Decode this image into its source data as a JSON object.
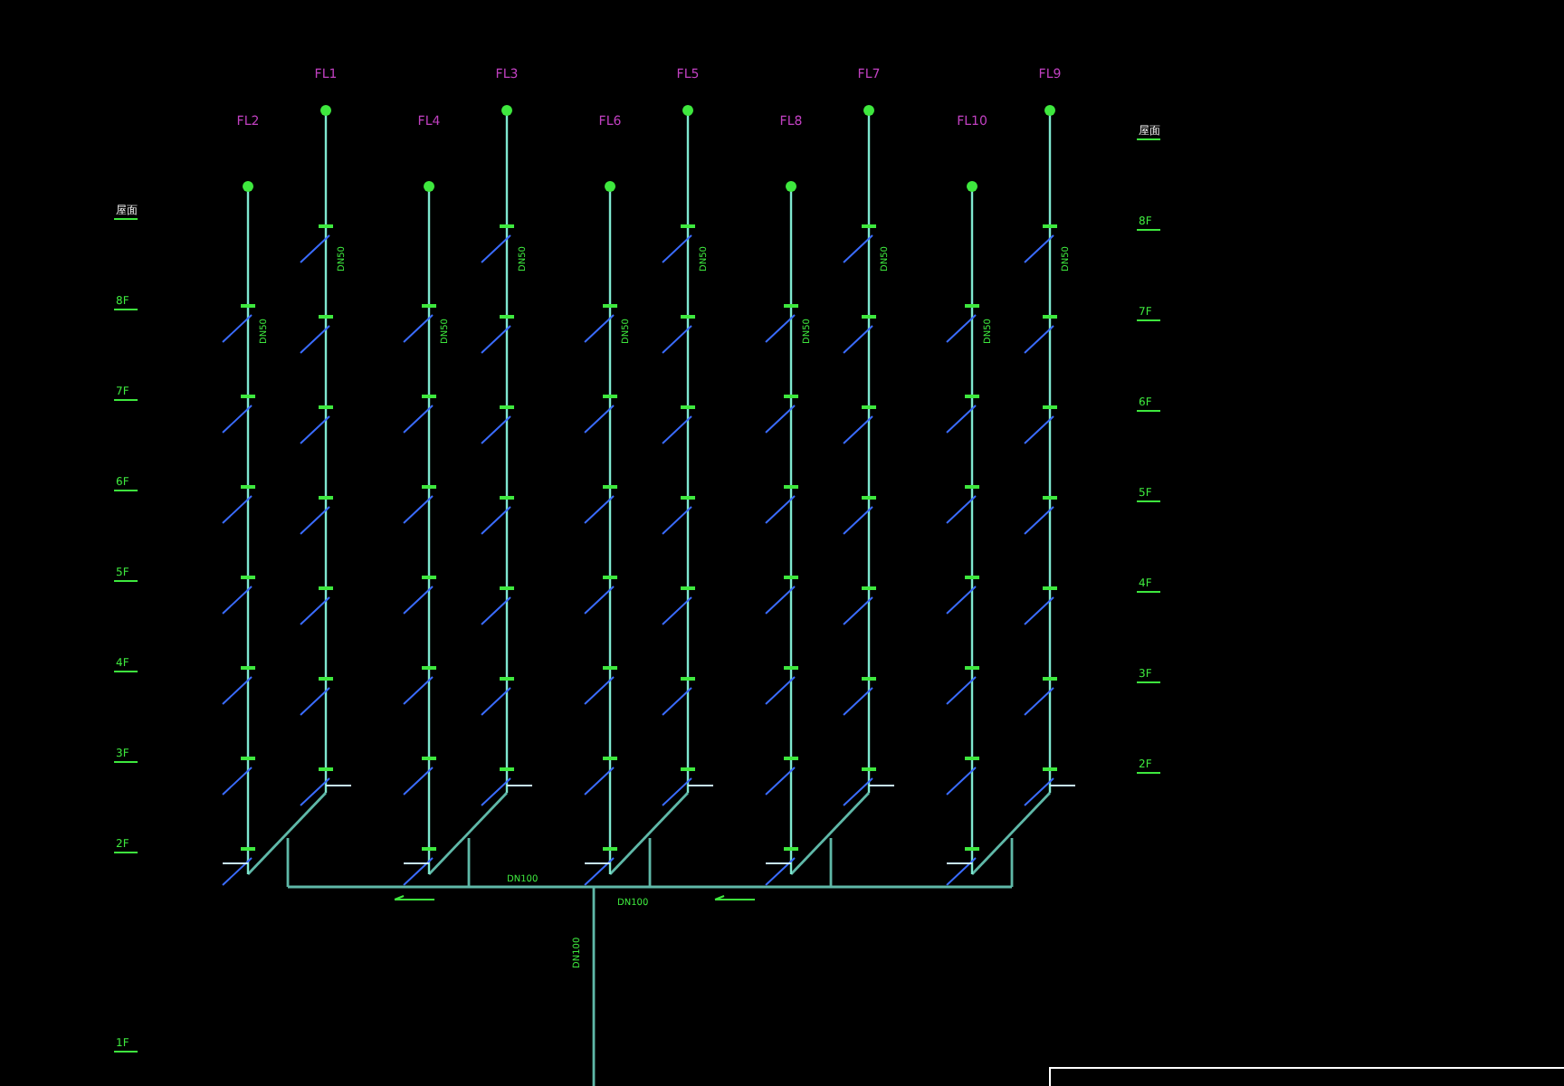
{
  "risers": [
    {
      "label": "FL1",
      "kind": "tall",
      "size": "DN50"
    },
    {
      "label": "FL2",
      "kind": "short",
      "size": "DN50"
    },
    {
      "label": "FL3",
      "kind": "tall",
      "size": "DN50"
    },
    {
      "label": "FL4",
      "kind": "short",
      "size": "DN50"
    },
    {
      "label": "FL5",
      "kind": "tall",
      "size": "DN50"
    },
    {
      "label": "FL6",
      "kind": "short",
      "size": "DN50"
    },
    {
      "label": "FL7",
      "kind": "tall",
      "size": "DN50"
    },
    {
      "label": "FL8",
      "kind": "short",
      "size": "DN50"
    },
    {
      "label": "FL9",
      "kind": "tall",
      "size": "DN50"
    },
    {
      "label": "FL10",
      "kind": "short",
      "size": "DN50"
    }
  ],
  "left_levels": [
    "屋面",
    "8F",
    "7F",
    "6F",
    "5F",
    "4F",
    "3F",
    "2F"
  ],
  "left_ground": "1F",
  "right_levels": [
    "屋面",
    "8F",
    "7F",
    "6F",
    "5F",
    "4F",
    "3F",
    "2F"
  ],
  "main_pipe": {
    "size": "DN100",
    "note": "DN100",
    "drop_size": "DN100"
  }
}
